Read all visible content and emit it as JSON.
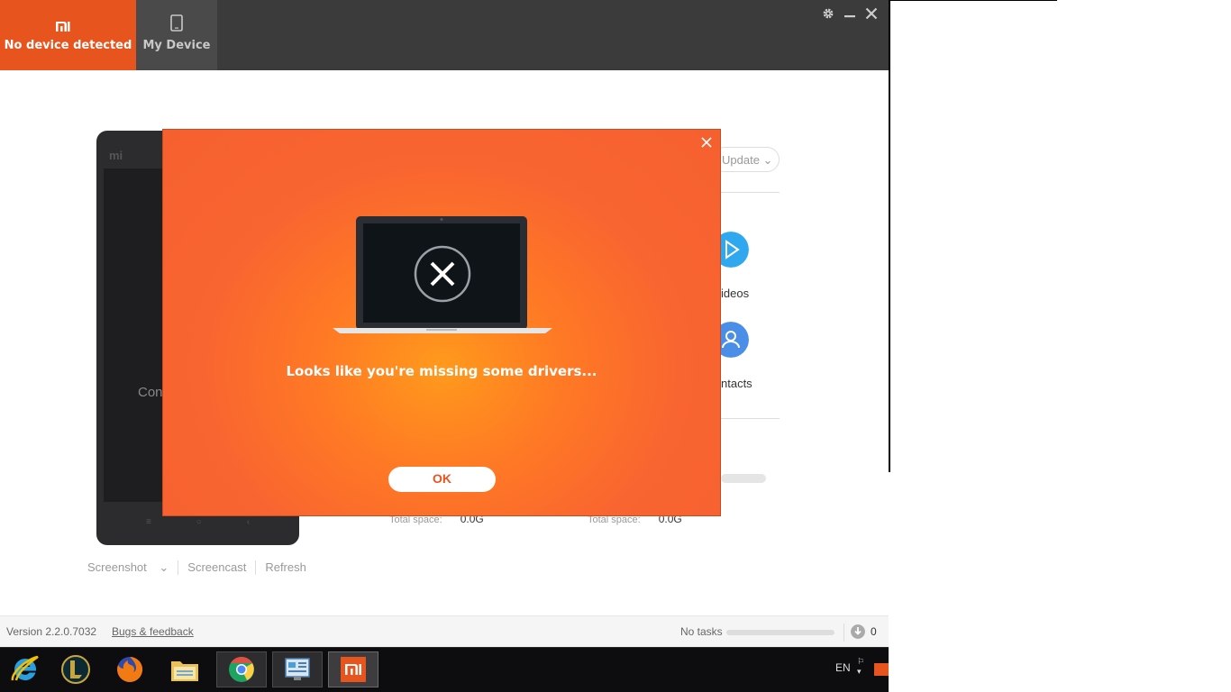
{
  "topbar": {
    "active_tab_label": "No device detected",
    "device_tab_label": "My Device"
  },
  "background": {
    "phone_logo": "mi",
    "phone_text": "Conn",
    "update_label": "Update",
    "videos_label": "ideos",
    "contacts_label": "ntacts",
    "total_label_1": "Total space:",
    "total_value_1": "0.0G",
    "total_label_2": "Total space:",
    "total_value_2": "0.0G",
    "bottom_links": [
      "Screenshot",
      "Screencast",
      "Refresh"
    ]
  },
  "modal": {
    "message": "Looks like you're missing some drivers...",
    "ok_label": "OK"
  },
  "status": {
    "version": "Version 2.2.0.7032",
    "bugs": "Bugs & feedback",
    "tasks": "No tasks",
    "count": "0"
  },
  "taskbar": {
    "lang": "EN"
  },
  "colors": {
    "accent": "#e8541e",
    "modal_bg": "#f96530"
  }
}
